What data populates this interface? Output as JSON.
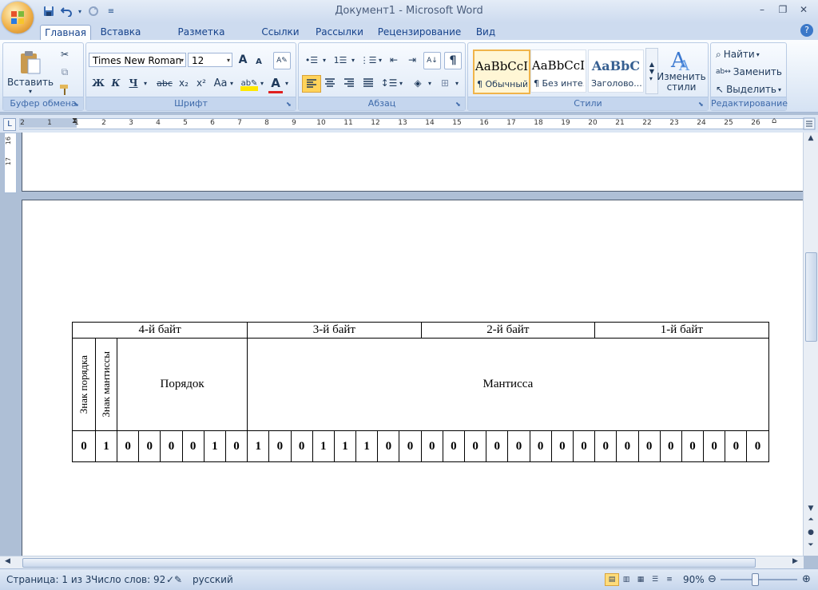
{
  "window": {
    "title": "Документ1 - Microsoft Word"
  },
  "tabs": [
    {
      "label": "Главная",
      "active": true
    },
    {
      "label": "Вставка"
    },
    {
      "label": "Разметка страницы"
    },
    {
      "label": "Ссылки"
    },
    {
      "label": "Рассылки"
    },
    {
      "label": "Рецензирование"
    },
    {
      "label": "Вид"
    }
  ],
  "ribbon": {
    "clipboard": {
      "label": "Буфер обмена",
      "paste": "Вставить"
    },
    "font": {
      "label": "Шрифт",
      "family": "Times New Roman",
      "size": "12",
      "bold": "Ж",
      "italic": "К",
      "underline": "Ч",
      "strike": "abc",
      "subscript": "x₂",
      "superscript": "x²",
      "change_case": "Aa",
      "grow": "A",
      "shrink": "A"
    },
    "paragraph": {
      "label": "Абзац",
      "pilcrow": "¶"
    },
    "styles": {
      "label": "Стили",
      "tiles": [
        {
          "sample": "AaBbCcI",
          "name": "¶ Обычный",
          "selected": true
        },
        {
          "sample": "AaBbCcI",
          "name": "¶ Без инте..."
        },
        {
          "sample": "AaBbC",
          "name": "Заголово..."
        }
      ],
      "change_styles": [
        "Изменить",
        "стили"
      ]
    },
    "editing": {
      "label": "Редактирование",
      "find": "Найти",
      "replace": "Заменить",
      "select": "Выделить"
    }
  },
  "ruler": {
    "numbers": [
      "2",
      "1",
      "1",
      "2",
      "3",
      "4",
      "5",
      "6",
      "7",
      "8",
      "9",
      "10",
      "11",
      "12",
      "13",
      "14",
      "15",
      "16",
      "17",
      "18",
      "19",
      "20",
      "21",
      "22",
      "23",
      "24",
      "25",
      "26"
    ],
    "vertical": [
      "16",
      "17"
    ]
  },
  "table": {
    "bytes": [
      "4-й байт",
      "3-й байт",
      "2-й байт",
      "1-й байт"
    ],
    "sign_order": "Знак порядка",
    "sign_mantissa": "Знак мантиссы",
    "order": "Порядок",
    "mantissa": "Мантисса",
    "bits": [
      "0",
      "1",
      "0",
      "0",
      "0",
      "0",
      "1",
      "0",
      "1",
      "0",
      "0",
      "1",
      "1",
      "1",
      "0",
      "0",
      "0",
      "0",
      "0",
      "0",
      "0",
      "0",
      "0",
      "0",
      "0",
      "0",
      "0",
      "0",
      "0",
      "0",
      "0",
      "0"
    ]
  },
  "status": {
    "page": "Страница: 1 из 3",
    "words": "Число слов: 92",
    "language": "русский",
    "zoom": "90%",
    "zoom_level": 90
  },
  "colors": {
    "accent": "#15428b",
    "ribbon_group_label": "#3e6aaa",
    "office_orb": "#f0b24a",
    "selected_style": "#f0b44a"
  }
}
